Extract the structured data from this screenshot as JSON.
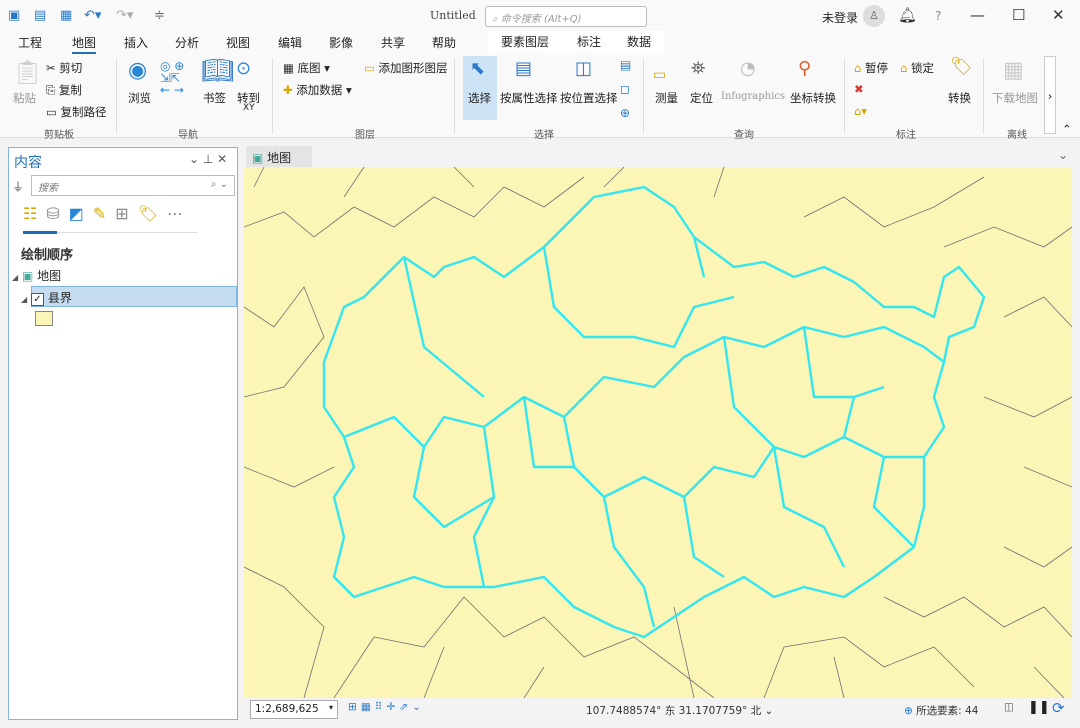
{
  "window": {
    "title": "Untitled",
    "command_search_placeholder": "命令搜索 (Alt+Q)",
    "user": "未登录",
    "help": "?",
    "minimize": "—",
    "maximize": "☐",
    "close": "✕"
  },
  "tabs": [
    "工程",
    "地图",
    "插入",
    "分析",
    "视图",
    "编辑",
    "影像",
    "共享",
    "帮助"
  ],
  "active_tab": "地图",
  "context_tabs": [
    "要素图层",
    "标注",
    "数据"
  ],
  "ribbon": {
    "clipboard": {
      "paste": "粘贴",
      "cut": "剪切",
      "copy": "复制",
      "copy_path": "复制路径",
      "label": "剪贴板"
    },
    "navigate": {
      "explore": "浏览",
      "bookmarks": "书签",
      "goto": "转到",
      "goto_sub": "XY",
      "label": "导航"
    },
    "layer": {
      "basemap": "底图",
      "add_data": "添加数据",
      "add_graphics_layer": "添加图形图层",
      "label": "图层"
    },
    "selection": {
      "select": "选择",
      "by_attribute": "按属性选择",
      "by_location": "按位置选择",
      "label": "选择"
    },
    "inquiry": {
      "measure": "测量",
      "locate": "定位",
      "infographics": "Infographics",
      "convert_coords": "坐标转换",
      "label": "查询"
    },
    "labeling": {
      "pause": "暂停",
      "lock": "锁定",
      "convert": "转换",
      "label": "标注"
    },
    "offline": {
      "download_map": "下载地图",
      "label": "离线"
    }
  },
  "contents": {
    "title": "内容",
    "search_placeholder": "搜索",
    "drawing_order": "绘制顺序",
    "map": "地图",
    "layer": "县界",
    "layer_checked": true,
    "symbol_color": "#fbf6b6"
  },
  "map_view": {
    "tab": "地图",
    "background": "#fbf6b6",
    "boundary_color": "#6e6e6e",
    "selection_color": "#33e6f0"
  },
  "status": {
    "scale": "1:2,689,625",
    "coords": "107.7488574° 东 31.1707759° 北",
    "selected_label": "所选要素:",
    "selected_count": "44"
  }
}
